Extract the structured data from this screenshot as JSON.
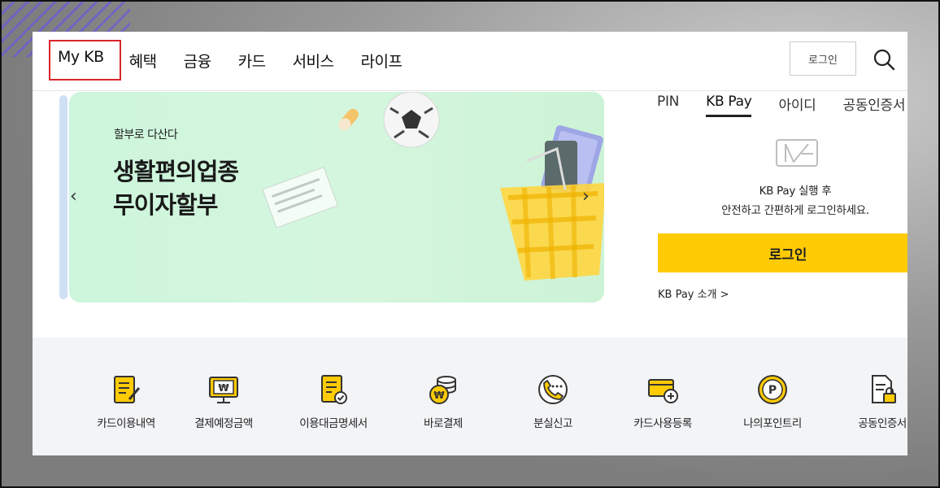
{
  "nav": {
    "items": [
      {
        "label": "My KB"
      },
      {
        "label": "혜택"
      },
      {
        "label": "금융"
      },
      {
        "label": "카드"
      },
      {
        "label": "서비스"
      },
      {
        "label": "라이프"
      }
    ],
    "login_label": "로그인"
  },
  "banner": {
    "subtitle": "할부로 다산다",
    "title_line1": "생활편의업종",
    "title_line2": "무이자할부",
    "prev_label": "‹",
    "next_label": "›"
  },
  "login_panel": {
    "tabs": [
      "PIN",
      "KB Pay",
      "아이디",
      "공동인증서"
    ],
    "message_line1": "KB Pay 실행 후",
    "message_line2": "안전하고 간편하게 로그인하세요.",
    "login_button": "로그인",
    "intro_link": "KB Pay 소개 >"
  },
  "quick_menu": [
    {
      "label": "카드이용내역",
      "icon": "card-usage-icon"
    },
    {
      "label": "결제예정금액",
      "icon": "payment-due-icon"
    },
    {
      "label": "이용대금명세서",
      "icon": "statement-icon"
    },
    {
      "label": "바로결제",
      "icon": "instant-pay-icon"
    },
    {
      "label": "분실신고",
      "icon": "lost-report-icon"
    },
    {
      "label": "카드사용등록",
      "icon": "card-register-icon"
    },
    {
      "label": "나의포인트리",
      "icon": "pointree-icon"
    },
    {
      "label": "공동인증서",
      "icon": "certificate-icon"
    }
  ],
  "colors": {
    "accent_yellow": "#ffcb05",
    "active_outline": "#d9262c",
    "banner_bg": "#cdf6dc",
    "icon_dark": "#3a3a3a"
  }
}
